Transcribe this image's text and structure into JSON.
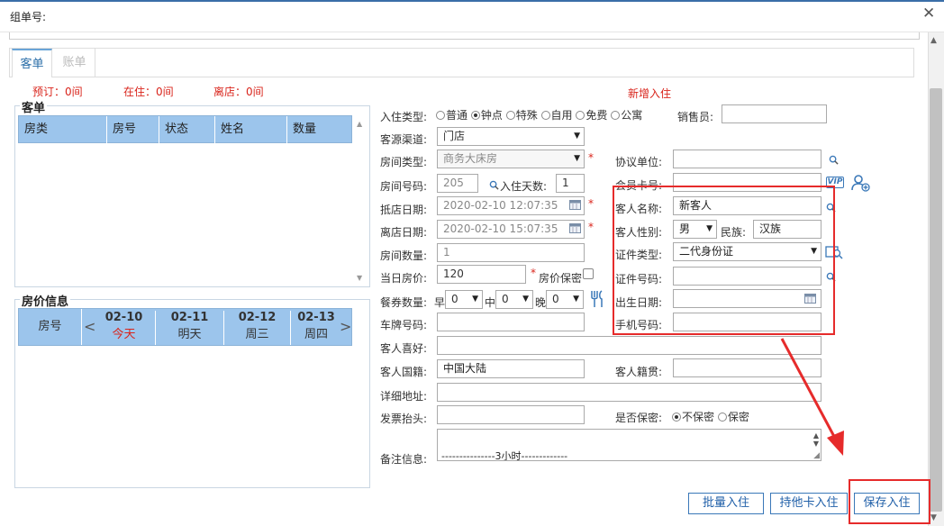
{
  "window": {
    "title": "组单号:",
    "close_icon": "close-icon"
  },
  "tabs": {
    "active": "客单",
    "inactive": "账单"
  },
  "counts": {
    "reserved": "预订：0间",
    "in_house": "在住：0间",
    "departing": "离店：0间"
  },
  "guest_panel": {
    "title": "客单",
    "headers": [
      "房类",
      "房号",
      "状态",
      "姓名",
      "数量"
    ]
  },
  "price_panel": {
    "title": "房价信息",
    "room_header": "房号",
    "dates": [
      {
        "date": "02-10",
        "day": "今天"
      },
      {
        "date": "02-11",
        "day": "明天"
      },
      {
        "date": "02-12",
        "day": "周三"
      },
      {
        "date": "02-13",
        "day": "周四"
      }
    ]
  },
  "form": {
    "heading": "新增入住",
    "checkin_type_label": "入住类型:",
    "checkin_types": [
      "普通",
      "钟点",
      "特殊",
      "自用",
      "免费",
      "公寓"
    ],
    "checkin_type_selected": "钟点",
    "salesperson_label": "销售员:",
    "source_label": "客源渠道:",
    "source_value": "门店",
    "room_type_label": "房间类型:",
    "room_type_value": "商务大床房",
    "agreement_label": "协议单位:",
    "room_no_label": "房间号码:",
    "room_no_value": "205",
    "days_label": "入住天数:",
    "days_value": "1",
    "member_label": "会员卡号:",
    "arrive_label": "抵店日期:",
    "arrive_value": "2020-02-10 12:07:35",
    "depart_label": "离店日期:",
    "depart_value": "2020-02-10 15:07:35",
    "guest_name_label": "客人名称:",
    "guest_name_value": "新客人",
    "gender_label": "客人性别:",
    "gender_value": "男",
    "ethnic_label": "民族:",
    "ethnic_value": "汉族",
    "room_count_label": "房间数量:",
    "room_count_value": "1",
    "id_type_label": "证件类型:",
    "id_type_value": "二代身份证",
    "rate_label": "当日房价:",
    "rate_value": "120",
    "rate_secret_label": "房价保密",
    "id_no_label": "证件号码:",
    "meal_label": "餐券数量:",
    "breakfast_label": "早",
    "lunch_label": "中",
    "dinner_label": "晚",
    "breakfast": "0",
    "lunch": "0",
    "dinner": "0",
    "birth_label": "出生日期:",
    "plate_label": "车牌号码:",
    "phone_label": "手机号码:",
    "hobby_label": "客人喜好:",
    "nationality_label": "客人国籍:",
    "nationality_value": "中国大陆",
    "native_label": "客人籍贯:",
    "address_label": "详细地址:",
    "invoice_label": "发票抬头:",
    "confidential_label": "是否保密:",
    "confidential_options": [
      "不保密",
      "保密"
    ],
    "confidential_selected": "不保密",
    "remark_label": "备注信息:",
    "remark_value": "---------------3小时-------------",
    "vip_icon_text": "VIP"
  },
  "buttons": {
    "batch": "批量入住",
    "other_card": "持他卡入住",
    "save": "保存入住"
  },
  "colors": {
    "accent": "#9cc5ec",
    "alert": "#e62b2b",
    "button_border": "#3a78b8"
  }
}
